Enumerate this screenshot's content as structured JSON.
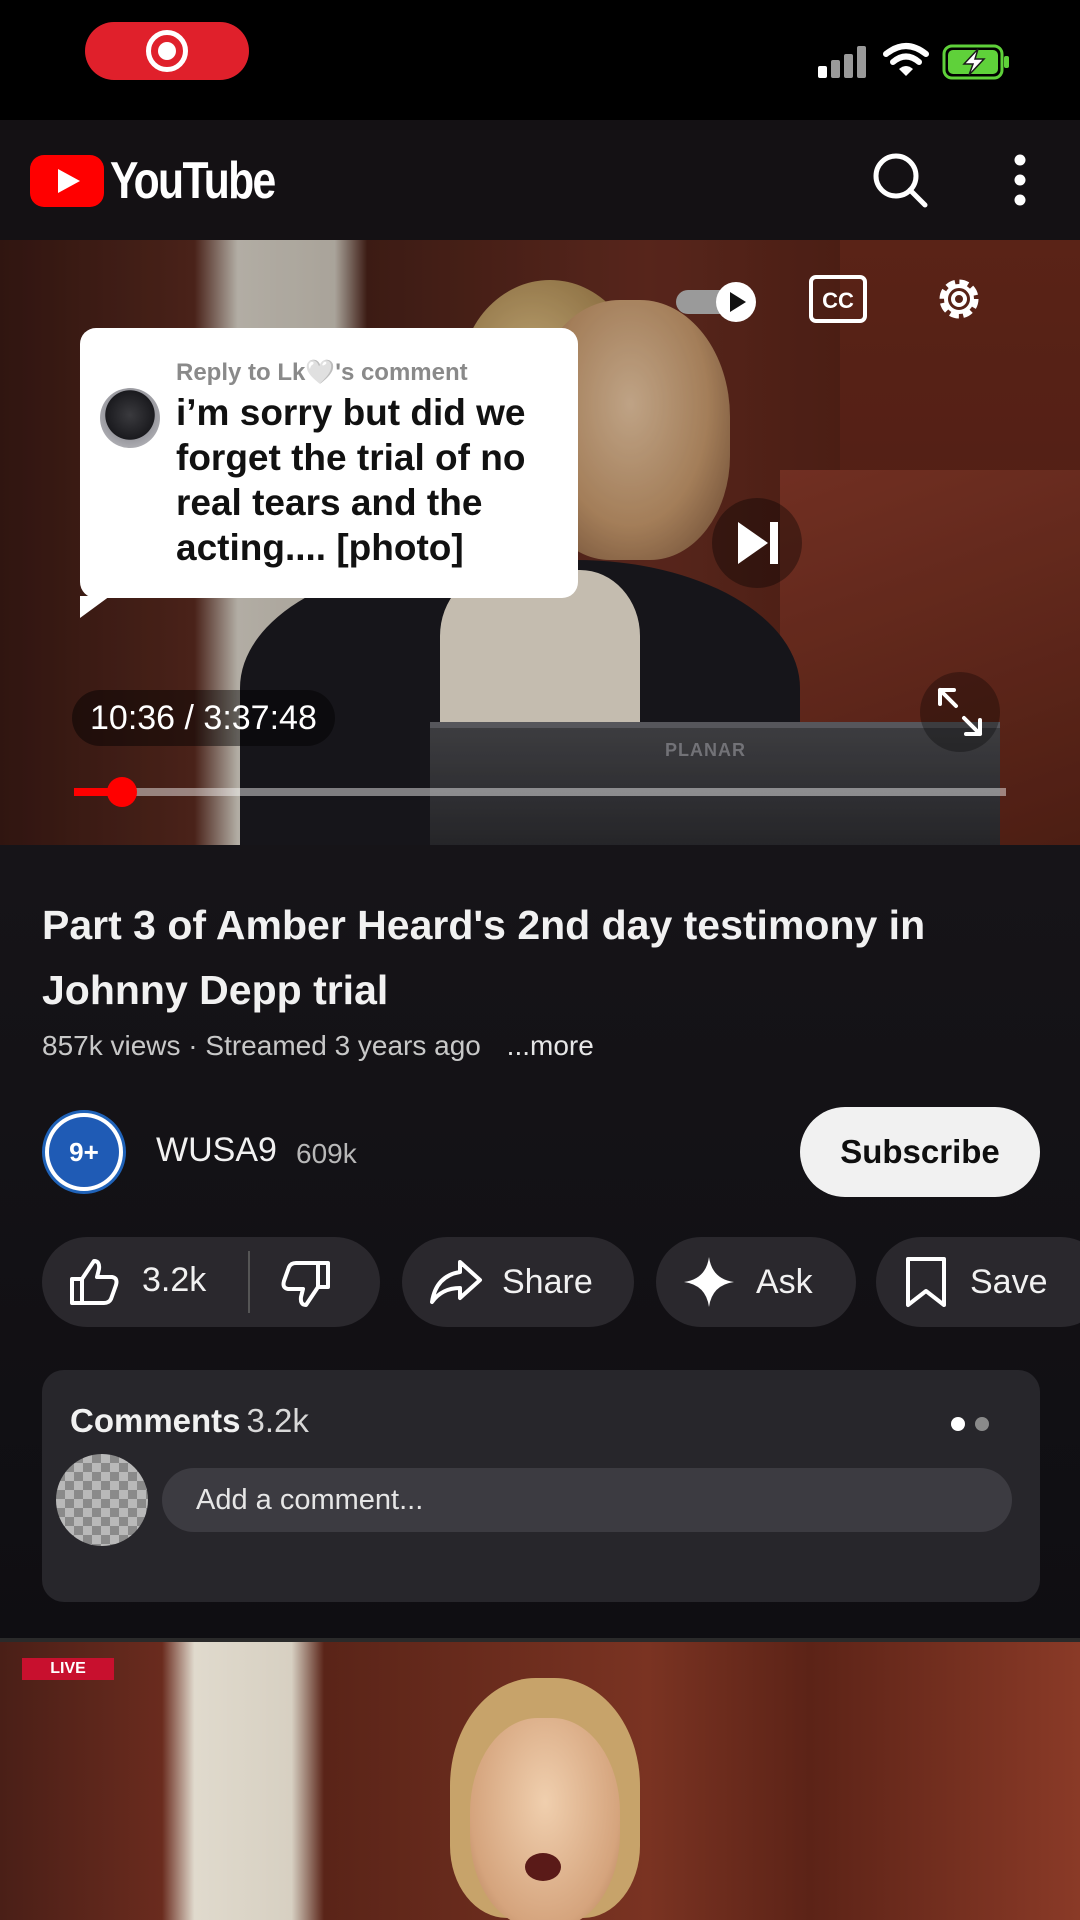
{
  "status_bar": {
    "recording_icon": "record-icon",
    "signal_icon": "signal-bars-icon",
    "wifi_icon": "wifi-icon",
    "battery_icon": "battery-charging-icon",
    "battery_color": "#5fd13a"
  },
  "header": {
    "app_name": "YouTube",
    "search_icon": "search-icon",
    "more_icon": "more-vertical-icon",
    "brand_color": "#ff0000"
  },
  "player": {
    "time_display": "10:36 / 3:37:48",
    "progress_fraction": 0.052,
    "monitor_brand": "PLANAR",
    "controls": [
      "autoplay-toggle-icon",
      "closed-captions-icon",
      "settings-gear-icon",
      "next-track-icon",
      "fullscreen-icon"
    ]
  },
  "reply_overlay": {
    "header": "Reply to Lk🤍's comment",
    "text": "i’m sorry but did we forget the trial of no real tears and the acting.... [photo]"
  },
  "video": {
    "title": "Part 3 of Amber Heard's 2nd day testimony in Johnny Depp trial",
    "meta": "857k views · Streamed 3 years ago",
    "more_label": "...more"
  },
  "channel": {
    "avatar_text": "9+",
    "name": "WUSA9",
    "subscribers": "609k",
    "subscribe_label": "Subscribe"
  },
  "actions": {
    "like_count": "3.2k",
    "share_label": "Share",
    "ask_label": "Ask",
    "save_label": "Save"
  },
  "comments": {
    "title": "Comments",
    "count": "3.2k",
    "placeholder": "Add a comment..."
  },
  "next_video": {
    "live_label": "LIVE"
  }
}
